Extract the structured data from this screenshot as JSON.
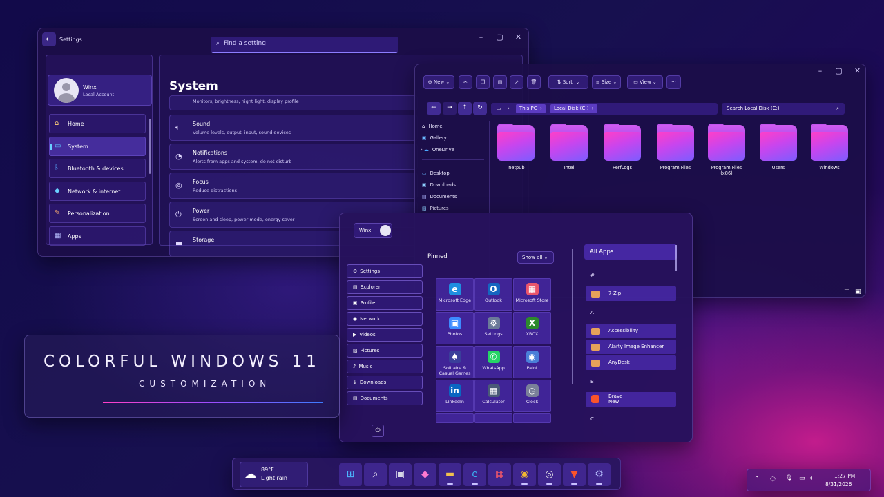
{
  "settings": {
    "title": "Settings",
    "search_placeholder": "Find a setting",
    "user": {
      "name": "Winx",
      "type": "Local Account"
    },
    "nav": [
      {
        "label": "Home",
        "icon": "home-icon"
      },
      {
        "label": "System",
        "icon": "monitor-icon"
      },
      {
        "label": "Bluetooth & devices",
        "icon": "bluetooth-icon"
      },
      {
        "label": "Network & internet",
        "icon": "wifi-icon"
      },
      {
        "label": "Personalization",
        "icon": "brush-icon"
      },
      {
        "label": "Apps",
        "icon": "apps-icon"
      }
    ],
    "heading": "System",
    "rows": [
      {
        "title": "",
        "desc": "Monitors, brightness, night light, display profile"
      },
      {
        "title": "Sound",
        "desc": "Volume levels, output, input, sound devices"
      },
      {
        "title": "Notifications",
        "desc": "Alerts from apps and system, do not disturb"
      },
      {
        "title": "Focus",
        "desc": "Reduce distractions"
      },
      {
        "title": "Power",
        "desc": "Screen and sleep, power mode, energy saver"
      },
      {
        "title": "Storage",
        "desc": ""
      }
    ]
  },
  "explorer": {
    "toolbar": {
      "new": "New",
      "sort": "Sort",
      "size": "Size",
      "view": "View",
      "more": "···"
    },
    "breadcrumb": [
      "This PC",
      "Local Disk (C:)"
    ],
    "search_placeholder": "Search Local Disk (C:)",
    "sidebar": [
      "Home",
      "Gallery",
      "OneDrive",
      "Desktop",
      "Downloads",
      "Documents",
      "Pictures"
    ],
    "folders": [
      "inetpub",
      "Intel",
      "PerfLogs",
      "Program Files",
      "Program Files (x86)",
      "Users",
      "Windows"
    ]
  },
  "start": {
    "user": "Winx",
    "pinned_label": "Pinned",
    "show_all": "Show all",
    "all_apps": "All Apps",
    "shortcuts": [
      "Settings",
      "Explorer",
      "Profile",
      "Network",
      "Videos",
      "Pictures",
      "Music",
      "Downloads",
      "Documents"
    ],
    "pinned": [
      {
        "label": "Microsoft Edge",
        "color": "#1f8fe0"
      },
      {
        "label": "Outlook",
        "color": "#1565c0"
      },
      {
        "label": "Microsoft Store",
        "color": "#e9556b"
      },
      {
        "label": "Photos",
        "color": "#3d8bff"
      },
      {
        "label": "Settings",
        "color": "#6b7a99"
      },
      {
        "label": "XBOX",
        "color": "#2d8a2d"
      },
      {
        "label": "Solitaire & Casual Games",
        "color": "#3a3f9a"
      },
      {
        "label": "WhatsApp",
        "color": "#25d366"
      },
      {
        "label": "Paint",
        "color": "#4a7fd8"
      },
      {
        "label": "LinkedIn",
        "color": "#0a66c2"
      },
      {
        "label": "Calculator",
        "color": "#4a5a78"
      },
      {
        "label": "Clock",
        "color": "#7a8099"
      }
    ],
    "app_groups": [
      {
        "letter": "#",
        "apps": [
          "7-Zip"
        ]
      },
      {
        "letter": "A",
        "apps": [
          "Accessibility",
          "Alarty Image Enhancer",
          "AnyDesk"
        ]
      },
      {
        "letter": "B",
        "apps": [
          "Brave"
        ]
      },
      {
        "letter": "C",
        "apps": []
      }
    ],
    "brave_sub": "New"
  },
  "titlecard": {
    "line1": "COLORFUL WINDOWS 11",
    "line2": "CUSTOMIZATION"
  },
  "taskbar": {
    "weather": {
      "temp": "89°F",
      "cond": "Light rain"
    },
    "icons": [
      "start-icon",
      "search-icon",
      "task-view-icon",
      "copilot-icon",
      "file-explorer-icon",
      "edge-icon",
      "store-icon",
      "chrome-icon",
      "obs-icon",
      "brave-icon",
      "settings-icon"
    ]
  },
  "tray": {
    "time": "1:27 PM",
    "date": "8/31/2026"
  }
}
